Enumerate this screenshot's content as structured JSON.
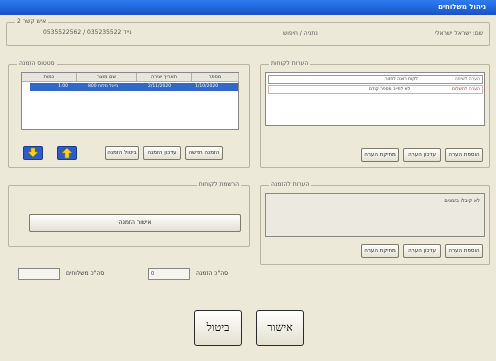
{
  "window": {
    "title": "ניהול משלוחים"
  },
  "header": {
    "label_top": "איש קשר 2",
    "phones": "0535522562 / 035235522 נייד",
    "branch": "נתניה / חיפוש",
    "customer_name": "שם: ישראל ישראלי"
  },
  "shipments": {
    "legend": "סטטוס הזמנה",
    "columns": [
      "מספר",
      "תאריך יצירה",
      "שם מוצר",
      "כמות"
    ],
    "rows": [
      {
        "id": "1/10/2020",
        "date": "2/11/2020",
        "product": "בייגל מלוח 800",
        "qty": "1.00"
      }
    ],
    "buttons": {
      "new": "הזמנה חדשה",
      "update": "עדכון הזמנה",
      "cancel": "ביטול הזמנה"
    }
  },
  "customer_notes": {
    "legend": "הערות לקוחות",
    "items": [
      {
        "tag": "הערה לשיחה",
        "text": "לקוח רוצה לחזור"
      },
      {
        "tag": "הערה לתשלום",
        "text": "לא לחייב מספר קודם"
      }
    ],
    "buttons": {
      "add": "הוספת הערה",
      "edit": "עדכון הערה",
      "delete": "מחיקת הערה"
    }
  },
  "confirm_section": {
    "legend": "הרשמת לקוחות",
    "confirm_button": "אישור הזמנה",
    "total_label": "סה\"כ הזמנה",
    "total_value": "0",
    "shipping_label": "סה\"כ משלוחים"
  },
  "order_notes": {
    "legend": "הערות להזמנה",
    "text": "לא קיבלו בזמנים",
    "buttons": {
      "add": "הוספת הערה",
      "edit": "עדכון הערה",
      "delete": "מחיקת הערה"
    }
  },
  "footer": {
    "cancel": "ביטול",
    "ok": "אישור"
  }
}
